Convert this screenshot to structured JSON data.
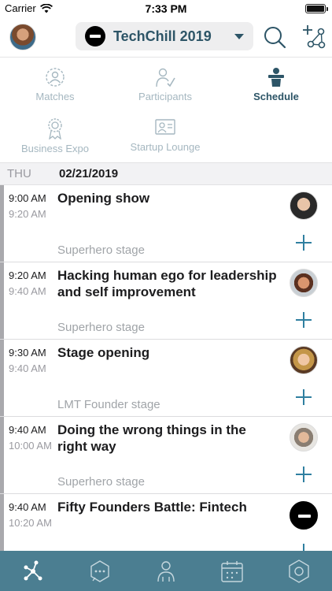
{
  "status": {
    "carrier": "Carrier",
    "time": "7:33 PM"
  },
  "header": {
    "event_name": "TechChill 2019"
  },
  "nav": [
    {
      "label": "Matches",
      "icon": "matches-icon",
      "active": false
    },
    {
      "label": "Participants",
      "icon": "participants-icon",
      "active": false
    },
    {
      "label": "Schedule",
      "icon": "schedule-icon",
      "active": true
    },
    {
      "label": "Business Expo",
      "icon": "expo-badge-icon",
      "active": false
    },
    {
      "label": "Startup Lounge",
      "icon": "lounge-icon",
      "active": false
    }
  ],
  "date": {
    "dow": "THU",
    "value": "02/21/2019"
  },
  "sessions": [
    {
      "start": "9:00 AM",
      "end": "9:20 AM",
      "title": "Opening show",
      "location": "Superhero stage"
    },
    {
      "start": "9:20 AM",
      "end": "9:40 AM",
      "title": "Hacking human ego for leadership and self improvement",
      "location": "Superhero stage"
    },
    {
      "start": "9:30 AM",
      "end": "9:40 AM",
      "title": "Stage opening",
      "location": "LMT Founder stage"
    },
    {
      "start": "9:40 AM",
      "end": "10:00 AM",
      "title": "Doing the wrong things in the right way",
      "location": "Superhero stage"
    },
    {
      "start": "9:40 AM",
      "end": "10:20 AM",
      "title": "Fifty Founders Battle: Fintech",
      "location": ""
    }
  ],
  "tabs": [
    "network-icon",
    "chat-icon",
    "people-icon",
    "calendar-icon",
    "settings-icon"
  ],
  "colors": {
    "accent": "#2d5567",
    "tabbar": "#4b7e91",
    "add": "#2f7fa0",
    "inactive": "#a5b7c0"
  }
}
